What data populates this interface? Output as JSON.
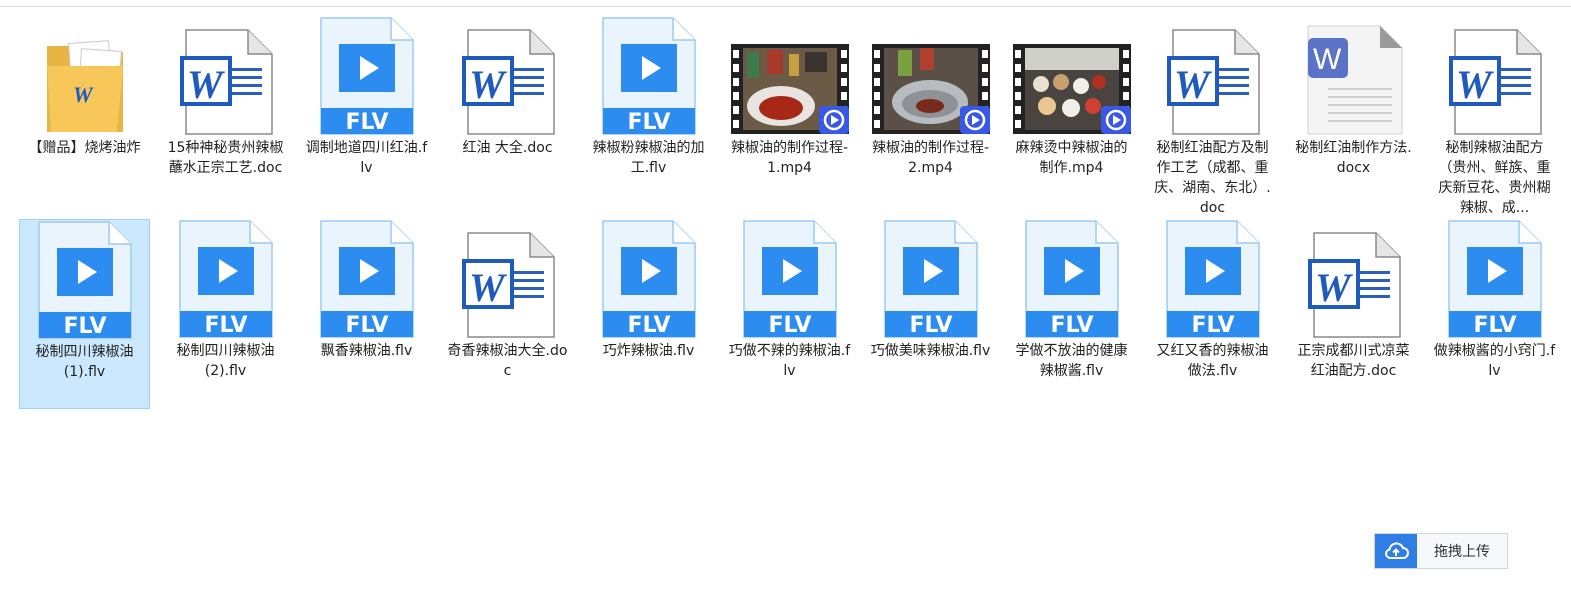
{
  "files_row1": [
    {
      "name": "【赠品】烧烤油炸",
      "kind": "folder"
    },
    {
      "name": "15种神秘贵州辣椒蘸水正宗工艺.doc",
      "kind": "doc"
    },
    {
      "name": "调制地道四川红油.flv",
      "kind": "flv"
    },
    {
      "name": "红油 大全.doc",
      "kind": "doc"
    },
    {
      "name": "辣椒粉辣椒油的加工.flv",
      "kind": "flv"
    },
    {
      "name": "辣椒油的制作过程-1.mp4",
      "kind": "video",
      "scene": 1
    },
    {
      "name": "辣椒油的制作过程-2.mp4",
      "kind": "video",
      "scene": 2
    },
    {
      "name": "麻辣烫中辣椒油的制作.mp4",
      "kind": "video",
      "scene": 3
    },
    {
      "name": "秘制红油配方及制作工艺（成都、重庆、湖南、东北）.doc",
      "kind": "doc"
    },
    {
      "name": "秘制红油制作方法.docx",
      "kind": "wps"
    },
    {
      "name": "秘制辣椒油配方（贵州、鲜族、重庆新豆花、贵州糊辣椒、成...",
      "kind": "doc"
    }
  ],
  "files_row2": [
    {
      "name": "秘制四川辣椒油(1).flv",
      "kind": "flv",
      "selected": true
    },
    {
      "name": "秘制四川辣椒油(2).flv",
      "kind": "flv"
    },
    {
      "name": "飘香辣椒油.flv",
      "kind": "flv"
    },
    {
      "name": "奇香辣椒油大全.doc",
      "kind": "doc"
    },
    {
      "name": "巧炸辣椒油.flv",
      "kind": "flv"
    },
    {
      "name": "巧做不辣的辣椒油.flv",
      "kind": "flv"
    },
    {
      "name": "巧做美味辣椒油.flv",
      "kind": "flv"
    },
    {
      "name": "学做不放油的健康辣椒酱.flv",
      "kind": "flv"
    },
    {
      "name": "又红又香的辣椒油做法.flv",
      "kind": "flv"
    },
    {
      "name": "正宗成都川式凉菜红油配方.doc",
      "kind": "doc"
    },
    {
      "name": "做辣椒酱的小窍门.flv",
      "kind": "flv"
    }
  ],
  "icons": {
    "folder": "folder-icon",
    "doc": "word-doc-icon",
    "wps": "wps-doc-icon",
    "flv": "flv-video-icon",
    "video": "video-thumbnail-icon",
    "upload": "cloud-upload-icon"
  },
  "badges": {
    "flv": "FLV",
    "word": "W"
  },
  "colors": {
    "flv_blue": "#2d8cf0",
    "word_blue": "#1f5bbf",
    "selection": "#cce8ff",
    "folder": "#f7c75a"
  },
  "upload_button": {
    "label": "拖拽上传"
  }
}
